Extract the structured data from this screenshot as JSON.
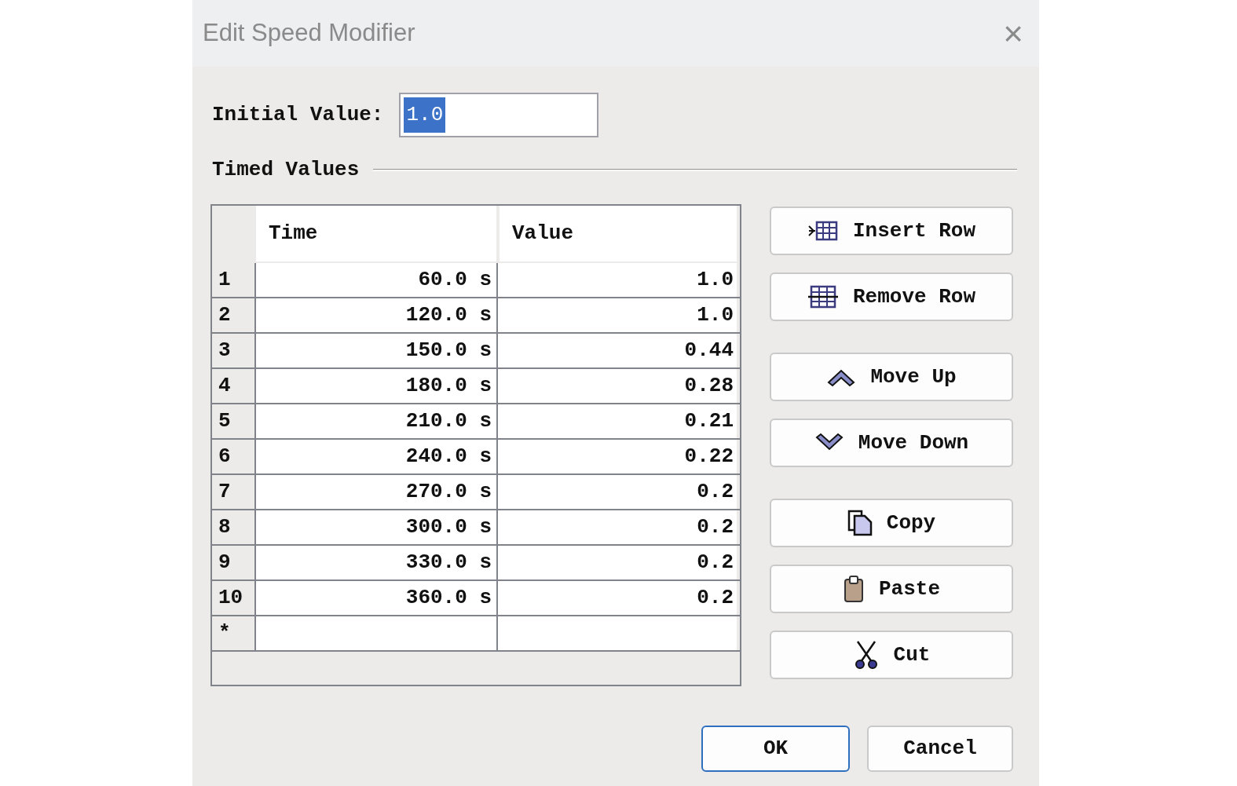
{
  "window": {
    "title": "Edit Speed Modifier",
    "close": "×"
  },
  "initial_value": {
    "label": "Initial Value:",
    "value": "1.0",
    "value_selected": true
  },
  "group": {
    "title": "Timed Values"
  },
  "table": {
    "columns": [
      "Time",
      "Value"
    ],
    "rows": [
      {
        "number": "1",
        "time": "60.0 s",
        "value": "1.0"
      },
      {
        "number": "2",
        "time": "120.0 s",
        "value": "1.0"
      },
      {
        "number": "3",
        "time": "150.0 s",
        "value": "0.44"
      },
      {
        "number": "4",
        "time": "180.0 s",
        "value": "0.28"
      },
      {
        "number": "5",
        "time": "210.0 s",
        "value": "0.21"
      },
      {
        "number": "6",
        "time": "240.0 s",
        "value": "0.22"
      },
      {
        "number": "7",
        "time": "270.0 s",
        "value": "0.2"
      },
      {
        "number": "8",
        "time": "300.0 s",
        "value": "0.2"
      },
      {
        "number": "9",
        "time": "330.0 s",
        "value": "0.2"
      },
      {
        "number": "10",
        "time": "360.0 s",
        "value": "0.2"
      }
    ],
    "new_row_marker": "*"
  },
  "side_button_groups": [
    [
      {
        "label": "Insert Row",
        "kind": "insert-row"
      },
      {
        "label": "Remove Row",
        "kind": "remove-row"
      }
    ],
    [
      {
        "label": "Move Up",
        "kind": "move-up"
      },
      {
        "label": "Move Down",
        "kind": "move-down"
      }
    ],
    [
      {
        "label": "Copy",
        "kind": "copy"
      },
      {
        "label": "Paste",
        "kind": "paste"
      },
      {
        "label": "Cut",
        "kind": "cut"
      }
    ]
  ],
  "buttons": [
    {
      "label": "OK",
      "default": true
    },
    {
      "label": "Cancel",
      "default": false
    }
  ]
}
